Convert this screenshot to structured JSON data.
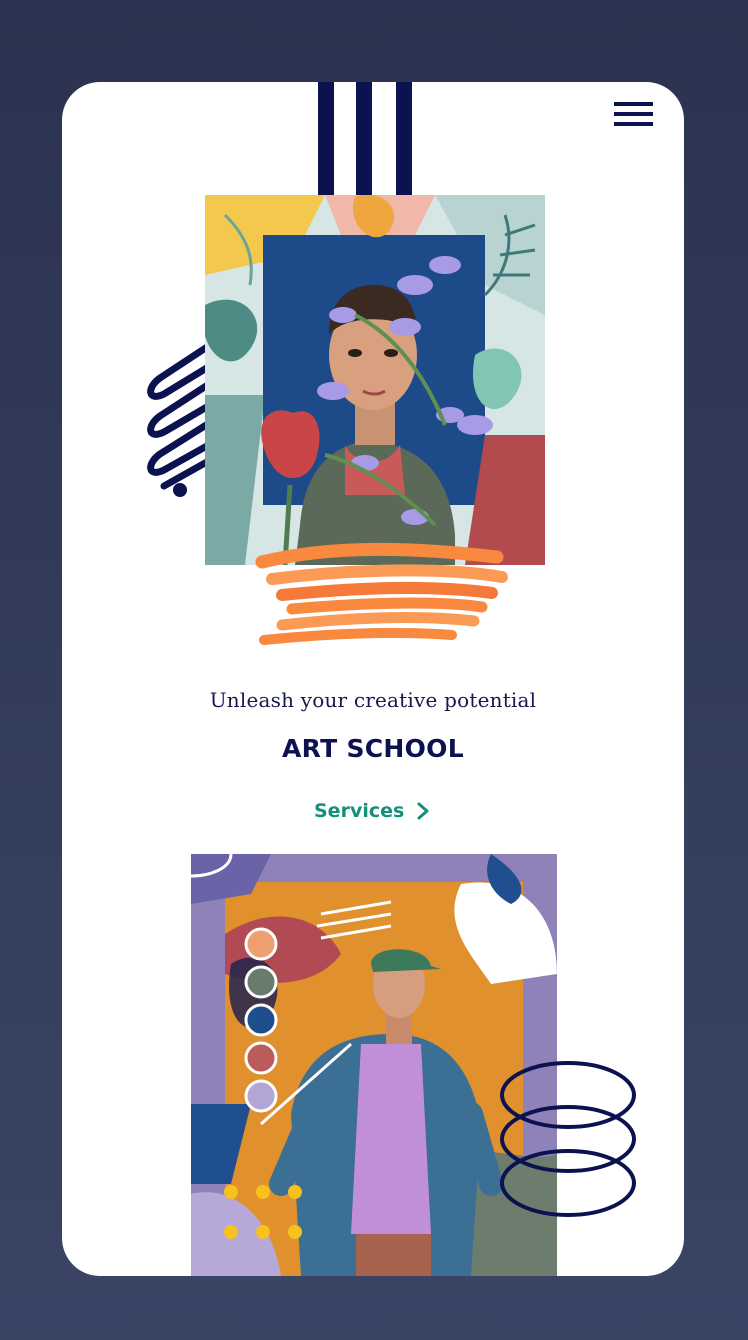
{
  "header": {
    "menu_icon": "hamburger-menu-icon"
  },
  "hero": {
    "tagline": "Unleash your creative potential",
    "title": "ART SCHOOL",
    "cta_label": "Services",
    "cta_icon": "chevron-right-icon"
  },
  "images": {
    "portrait_1": "collage portrait with tulips",
    "portrait_2": "collage portrait with cap and jacket"
  },
  "palette": {
    "navy": "#0c1250",
    "green": "#13907a",
    "orange": "#f8893f",
    "swatches": [
      "#f0a070",
      "#697b6c",
      "#1e4f8c",
      "#b95c5a",
      "#b3a6d4"
    ]
  }
}
